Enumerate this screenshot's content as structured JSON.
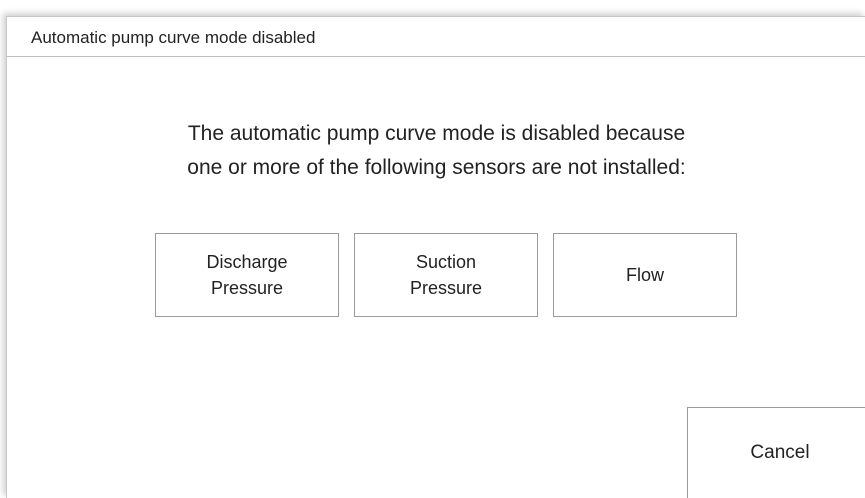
{
  "dialog": {
    "title": "Automatic pump curve mode disabled",
    "message": {
      "line1": "The automatic pump curve mode is disabled because",
      "line2": "one or more of the following sensors are not installed:"
    },
    "sensors": [
      {
        "line1": "Discharge",
        "line2": "Pressure"
      },
      {
        "line1": "Suction",
        "line2": "Pressure"
      },
      {
        "line1": "Flow",
        "line2": ""
      }
    ],
    "cancel_label": "Cancel"
  }
}
